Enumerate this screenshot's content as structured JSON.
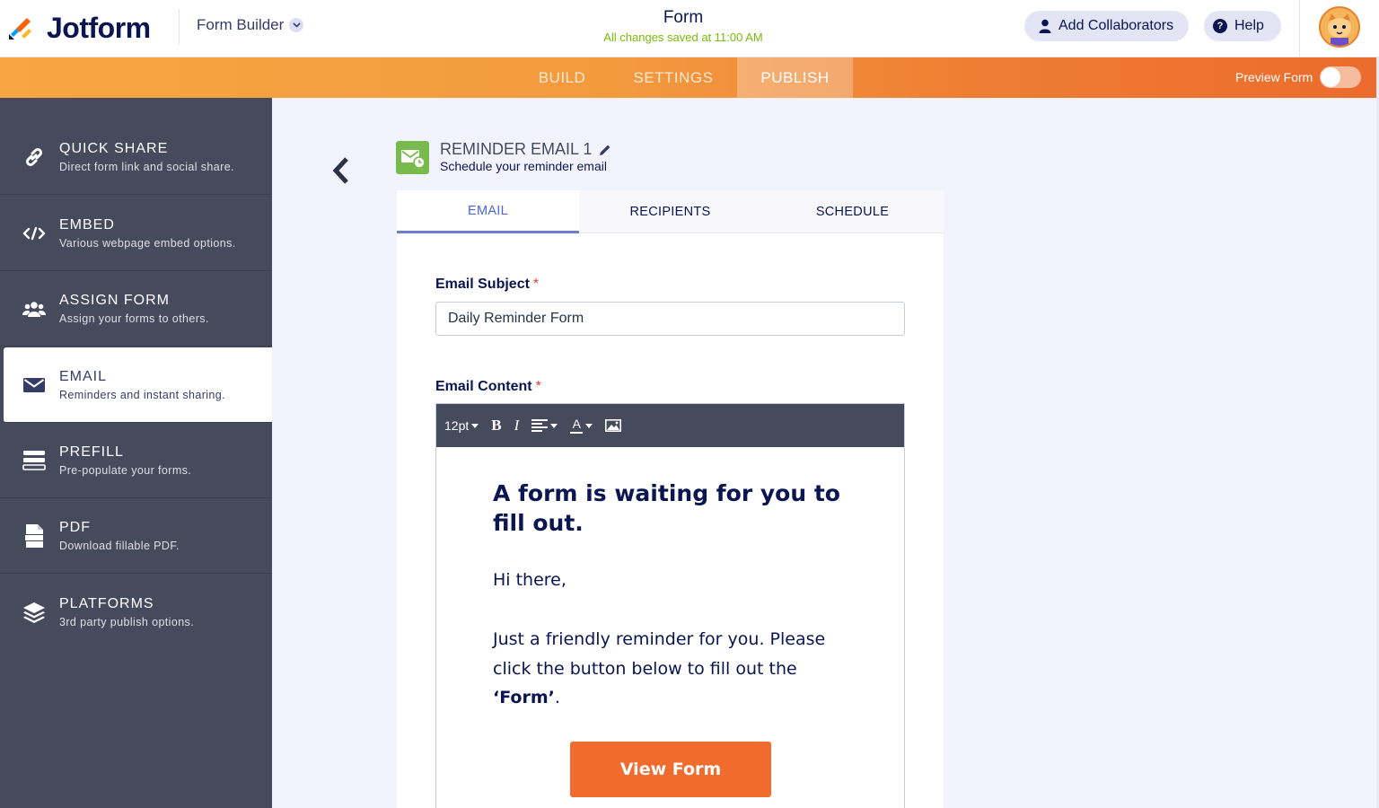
{
  "header": {
    "brand": "Jotform",
    "builder_menu": "Form Builder",
    "form_title": "Form",
    "saved_status": "All changes saved at 11:00 AM",
    "collaborators_label": "Add Collaborators",
    "help_label": "Help"
  },
  "nav": {
    "tabs": [
      {
        "label": "BUILD",
        "active": false
      },
      {
        "label": "SETTINGS",
        "active": false
      },
      {
        "label": "PUBLISH",
        "active": true
      }
    ],
    "preview_label": "Preview Form",
    "preview_enabled": false
  },
  "sidebar": {
    "items": [
      {
        "title": "QUICK SHARE",
        "desc": "Direct form link and social share.",
        "icon": "link-icon",
        "active": false
      },
      {
        "title": "EMBED",
        "desc": "Various webpage embed options.",
        "icon": "code-icon",
        "active": false
      },
      {
        "title": "ASSIGN FORM",
        "desc": "Assign your forms to others.",
        "icon": "users-icon",
        "active": false
      },
      {
        "title": "EMAIL",
        "desc": "Reminders and instant sharing.",
        "icon": "envelope-icon",
        "active": true
      },
      {
        "title": "PREFILL",
        "desc": "Pre-populate your forms.",
        "icon": "prefill-icon",
        "active": false
      },
      {
        "title": "PDF",
        "desc": "Download fillable PDF.",
        "icon": "pdf-icon",
        "active": false
      },
      {
        "title": "PLATFORMS",
        "desc": "3rd party publish options.",
        "icon": "layers-icon",
        "active": false
      }
    ]
  },
  "reminder": {
    "title": "REMINDER EMAIL 1",
    "subtitle": "Schedule your reminder email",
    "tabs": [
      {
        "label": "EMAIL",
        "active": true
      },
      {
        "label": "RECIPIENTS",
        "active": false
      },
      {
        "label": "SCHEDULE",
        "active": false
      }
    ],
    "subject_label": "Email Subject",
    "subject_value": "Daily Reminder Form",
    "content_label": "Email Content",
    "required_mark": "*",
    "toolbar": {
      "font_size": "12pt",
      "bold": "B",
      "italic": "I",
      "text_color": "A"
    },
    "email": {
      "heading": "A form is waiting for you to fill out.",
      "greeting": "Hi there,",
      "body_prefix": "Just a friendly reminder for you. Please click the button below to fill out the ",
      "body_form_name": "‘Form’",
      "body_suffix": ".",
      "button_label": "View Form"
    }
  },
  "colors": {
    "accent_orange": "#f06c2e",
    "sidebar_bg": "#454a5c",
    "saved_green": "#78bb07",
    "tab_active": "#4b67d1"
  }
}
